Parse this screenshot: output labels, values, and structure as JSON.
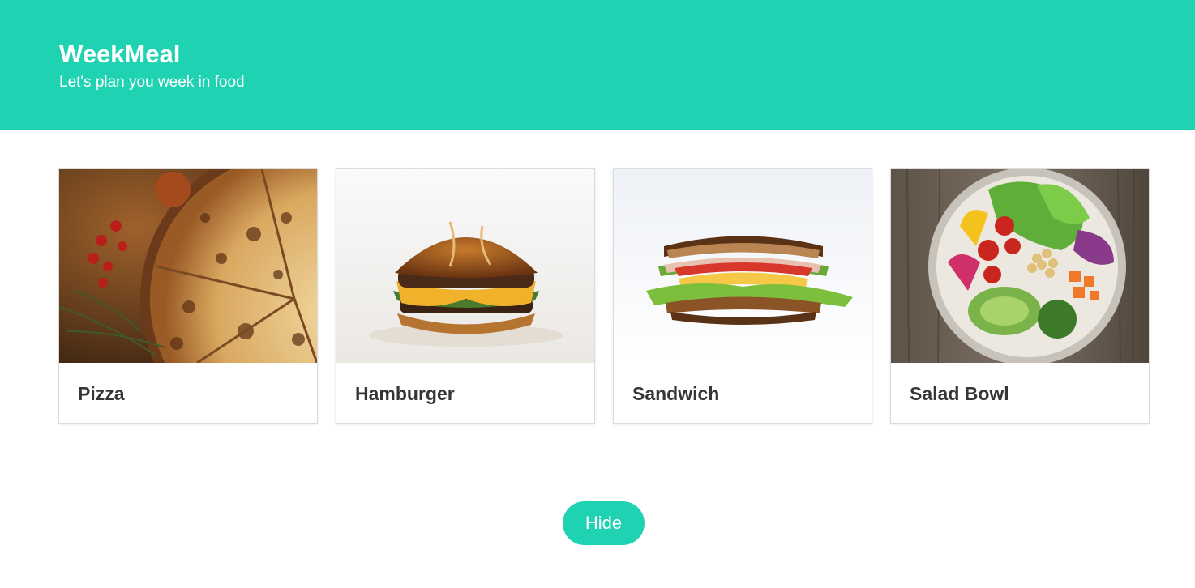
{
  "colors": {
    "accent": "#1fd3b2"
  },
  "header": {
    "title": "WeekMeal",
    "subtitle": "Let's plan you week in food"
  },
  "meals": [
    {
      "name": "Pizza",
      "image_icon": "pizza-photo"
    },
    {
      "name": "Hamburger",
      "image_icon": "hamburger-photo"
    },
    {
      "name": "Sandwich",
      "image_icon": "sandwich-photo"
    },
    {
      "name": "Salad Bowl",
      "image_icon": "salad-bowl-photo"
    }
  ],
  "actions": {
    "hide_label": "Hide"
  }
}
